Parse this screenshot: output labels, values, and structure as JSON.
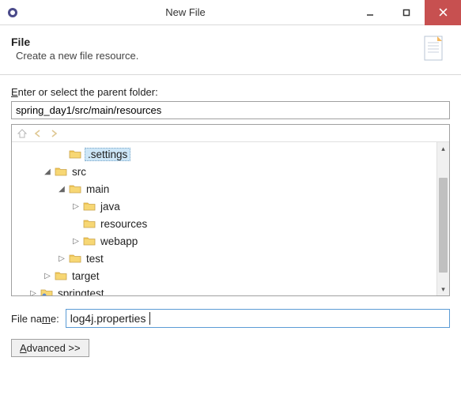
{
  "window": {
    "title": "New File"
  },
  "header": {
    "title": "File",
    "description": "Create a new file resource."
  },
  "parentFolder": {
    "label_pre": "E",
    "label_rest": "nter or select the parent folder:",
    "value": "spring_day1/src/main/resources"
  },
  "tree": {
    "items": [
      {
        "indent": 2,
        "expander": "none",
        "icon": "folder",
        "label": ".settings",
        "selected": true
      },
      {
        "indent": 1,
        "expander": "open",
        "icon": "folder",
        "label": "src"
      },
      {
        "indent": 2,
        "expander": "open",
        "icon": "folder",
        "label": "main"
      },
      {
        "indent": 3,
        "expander": "closed",
        "icon": "folder",
        "label": "java"
      },
      {
        "indent": 3,
        "expander": "none",
        "icon": "folder",
        "label": "resources"
      },
      {
        "indent": 3,
        "expander": "closed",
        "icon": "folder",
        "label": "webapp"
      },
      {
        "indent": 2,
        "expander": "closed",
        "icon": "folder",
        "label": "test"
      },
      {
        "indent": 1,
        "expander": "closed",
        "icon": "folder",
        "label": "target"
      },
      {
        "indent": 0,
        "expander": "closed",
        "icon": "project",
        "label": "springtest"
      }
    ]
  },
  "fileName": {
    "label_pre": "File na",
    "label_u": "m",
    "label_post": "e:",
    "value": "log4j.properties"
  },
  "advanced": {
    "label_u": "A",
    "label_rest": "dvanced >>"
  }
}
